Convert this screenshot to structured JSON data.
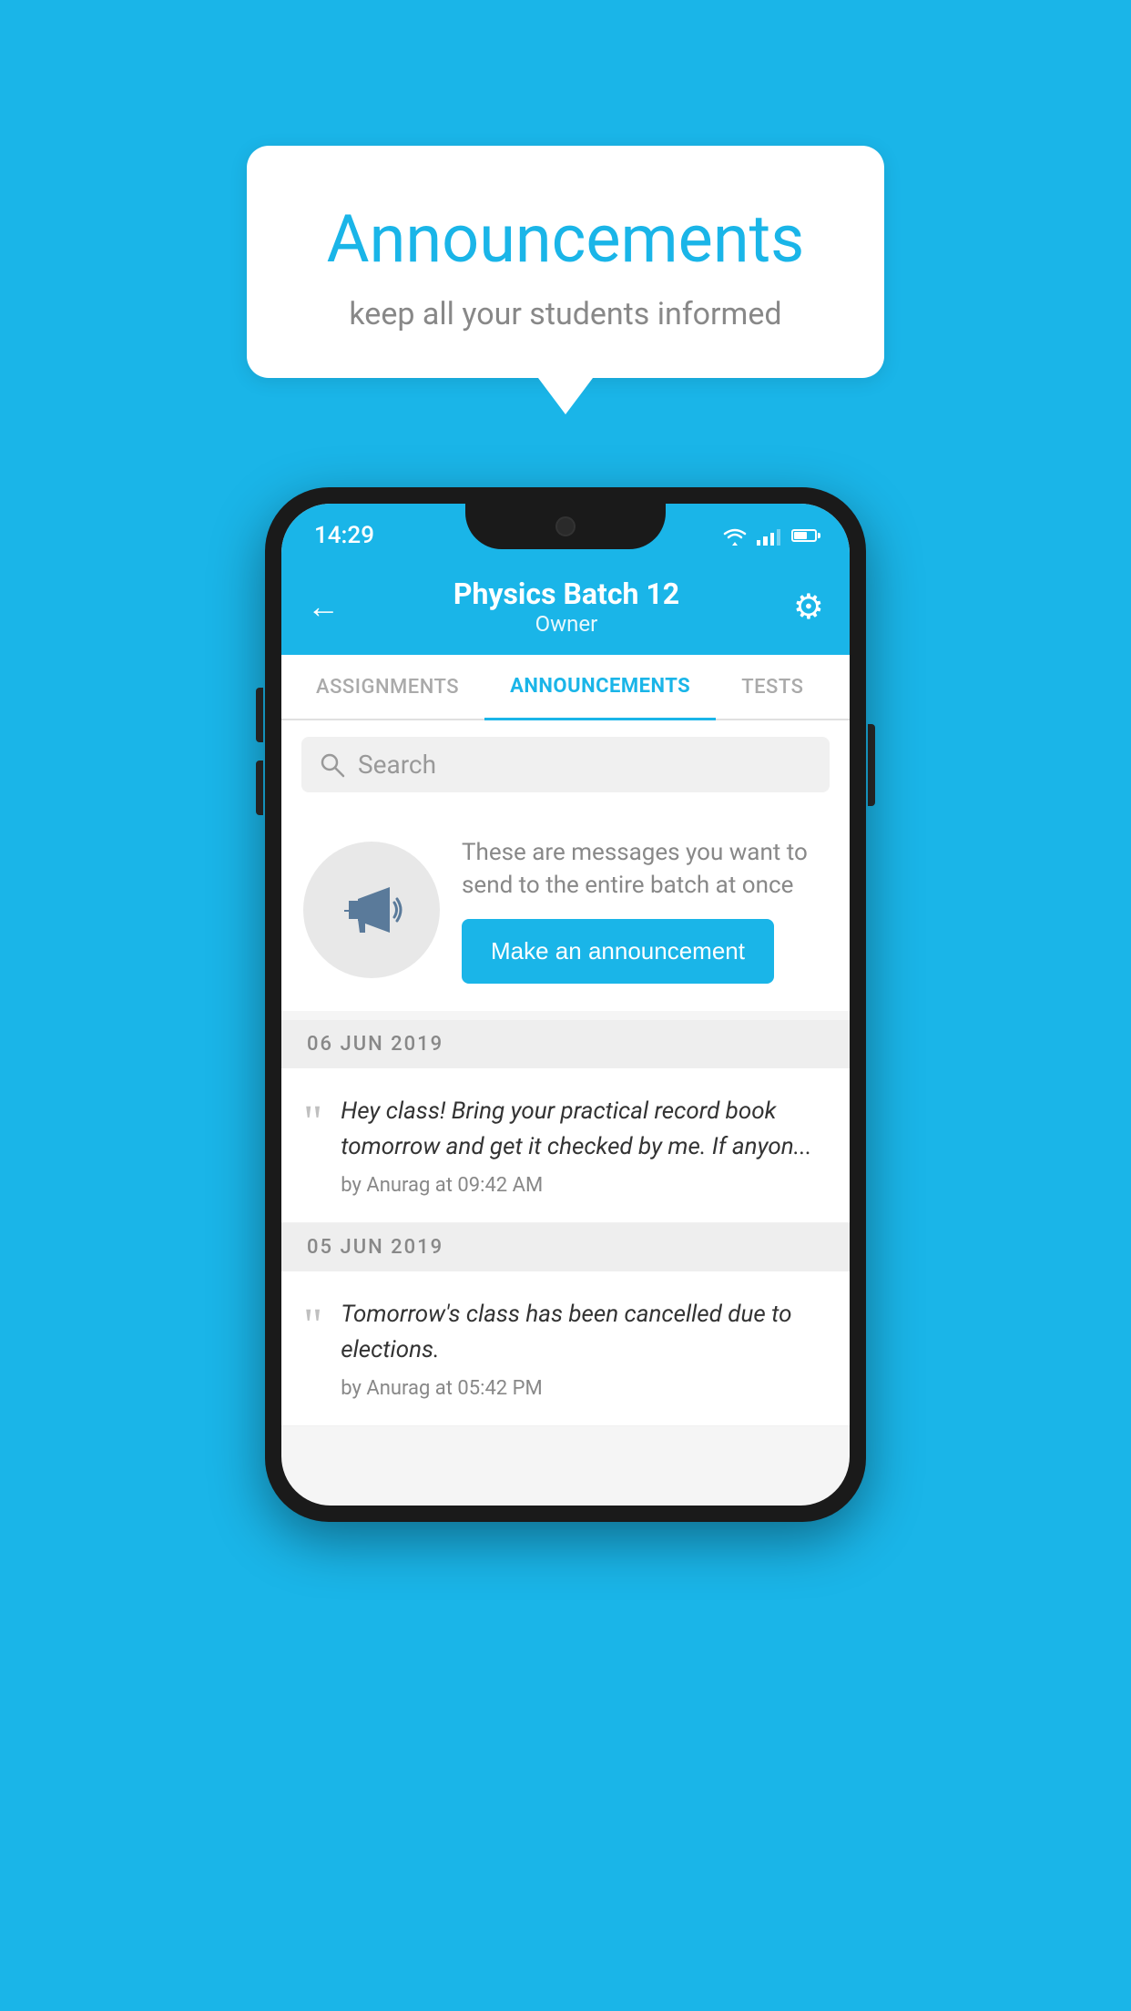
{
  "page": {
    "background_color": "#1ab5e8"
  },
  "speech_bubble": {
    "title": "Announcements",
    "subtitle": "keep all your students informed"
  },
  "phone": {
    "status_bar": {
      "time": "14:29"
    },
    "header": {
      "batch_name": "Physics Batch 12",
      "role": "Owner",
      "back_label": "←",
      "settings_label": "⚙"
    },
    "tabs": [
      {
        "label": "ASSIGNMENTS",
        "active": false
      },
      {
        "label": "ANNOUNCEMENTS",
        "active": true
      },
      {
        "label": "TESTS",
        "active": false
      }
    ],
    "search": {
      "placeholder": "Search"
    },
    "promo_section": {
      "description": "These are messages you want to send to the entire batch at once",
      "button_label": "Make an announcement"
    },
    "date_groups": [
      {
        "date_label": "06  JUN  2019",
        "announcements": [
          {
            "text": "Hey class! Bring your practical record book tomorrow and get it checked by me. If anyon...",
            "author": "by Anurag at 09:42 AM"
          }
        ]
      },
      {
        "date_label": "05  JUN  2019",
        "announcements": [
          {
            "text": "Tomorrow's class has been cancelled due to elections.",
            "author": "by Anurag at 05:42 PM"
          }
        ]
      }
    ]
  }
}
